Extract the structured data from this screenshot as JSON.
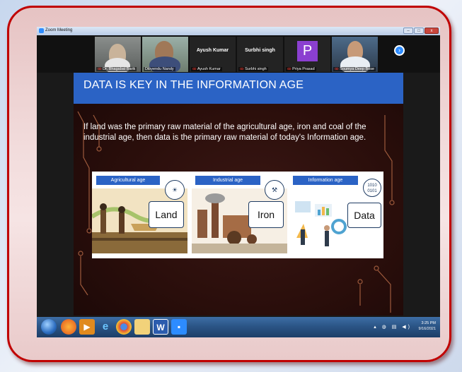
{
  "window": {
    "title": "Zoom Meeting",
    "controls": [
      "–",
      "□",
      "x"
    ]
  },
  "participants": [
    {
      "name": "Dr. Bhagabat Barik",
      "type": "video"
    },
    {
      "name": "Dibyendu Nandy",
      "type": "video"
    },
    {
      "name": "Ayush Kumar",
      "type": "name"
    },
    {
      "name": "Surbhi singh",
      "type": "name"
    },
    {
      "name": "Priya Prasad",
      "type": "avatar",
      "initial": "P"
    },
    {
      "name": "Soumya Deep Bose",
      "type": "video"
    }
  ],
  "gallery_next_icon": "chevron-right-icon",
  "slide": {
    "title": "DATA IS KEY IN THE INFORMATION AGE",
    "body": "If land was the primary raw material of the agricultural age, iron and coal of the industrial age, then data is the primary raw material of today's Information age.",
    "ages": [
      {
        "label": "Agricultural age",
        "word": "Land",
        "icon": "sun-field-icon"
      },
      {
        "label": "Industrial age",
        "word": "Iron",
        "icon": "anvil-icon"
      },
      {
        "label": "Information age",
        "word": "Data",
        "icon": "binary-icon",
        "binary": "1010\n0101"
      }
    ]
  },
  "taskbar": {
    "apps": [
      "windows-start-icon",
      "firefox-icon",
      "media-player-icon",
      "internet-explorer-icon",
      "chrome-icon",
      "file-explorer-icon",
      "word-icon",
      "zoom-icon"
    ],
    "time": "3:25 PM",
    "date": "9/16/2021"
  },
  "colors": {
    "frame_border": "#c00000",
    "slide_banner": "#2b63c5",
    "zoom_blue": "#2d8cff"
  }
}
